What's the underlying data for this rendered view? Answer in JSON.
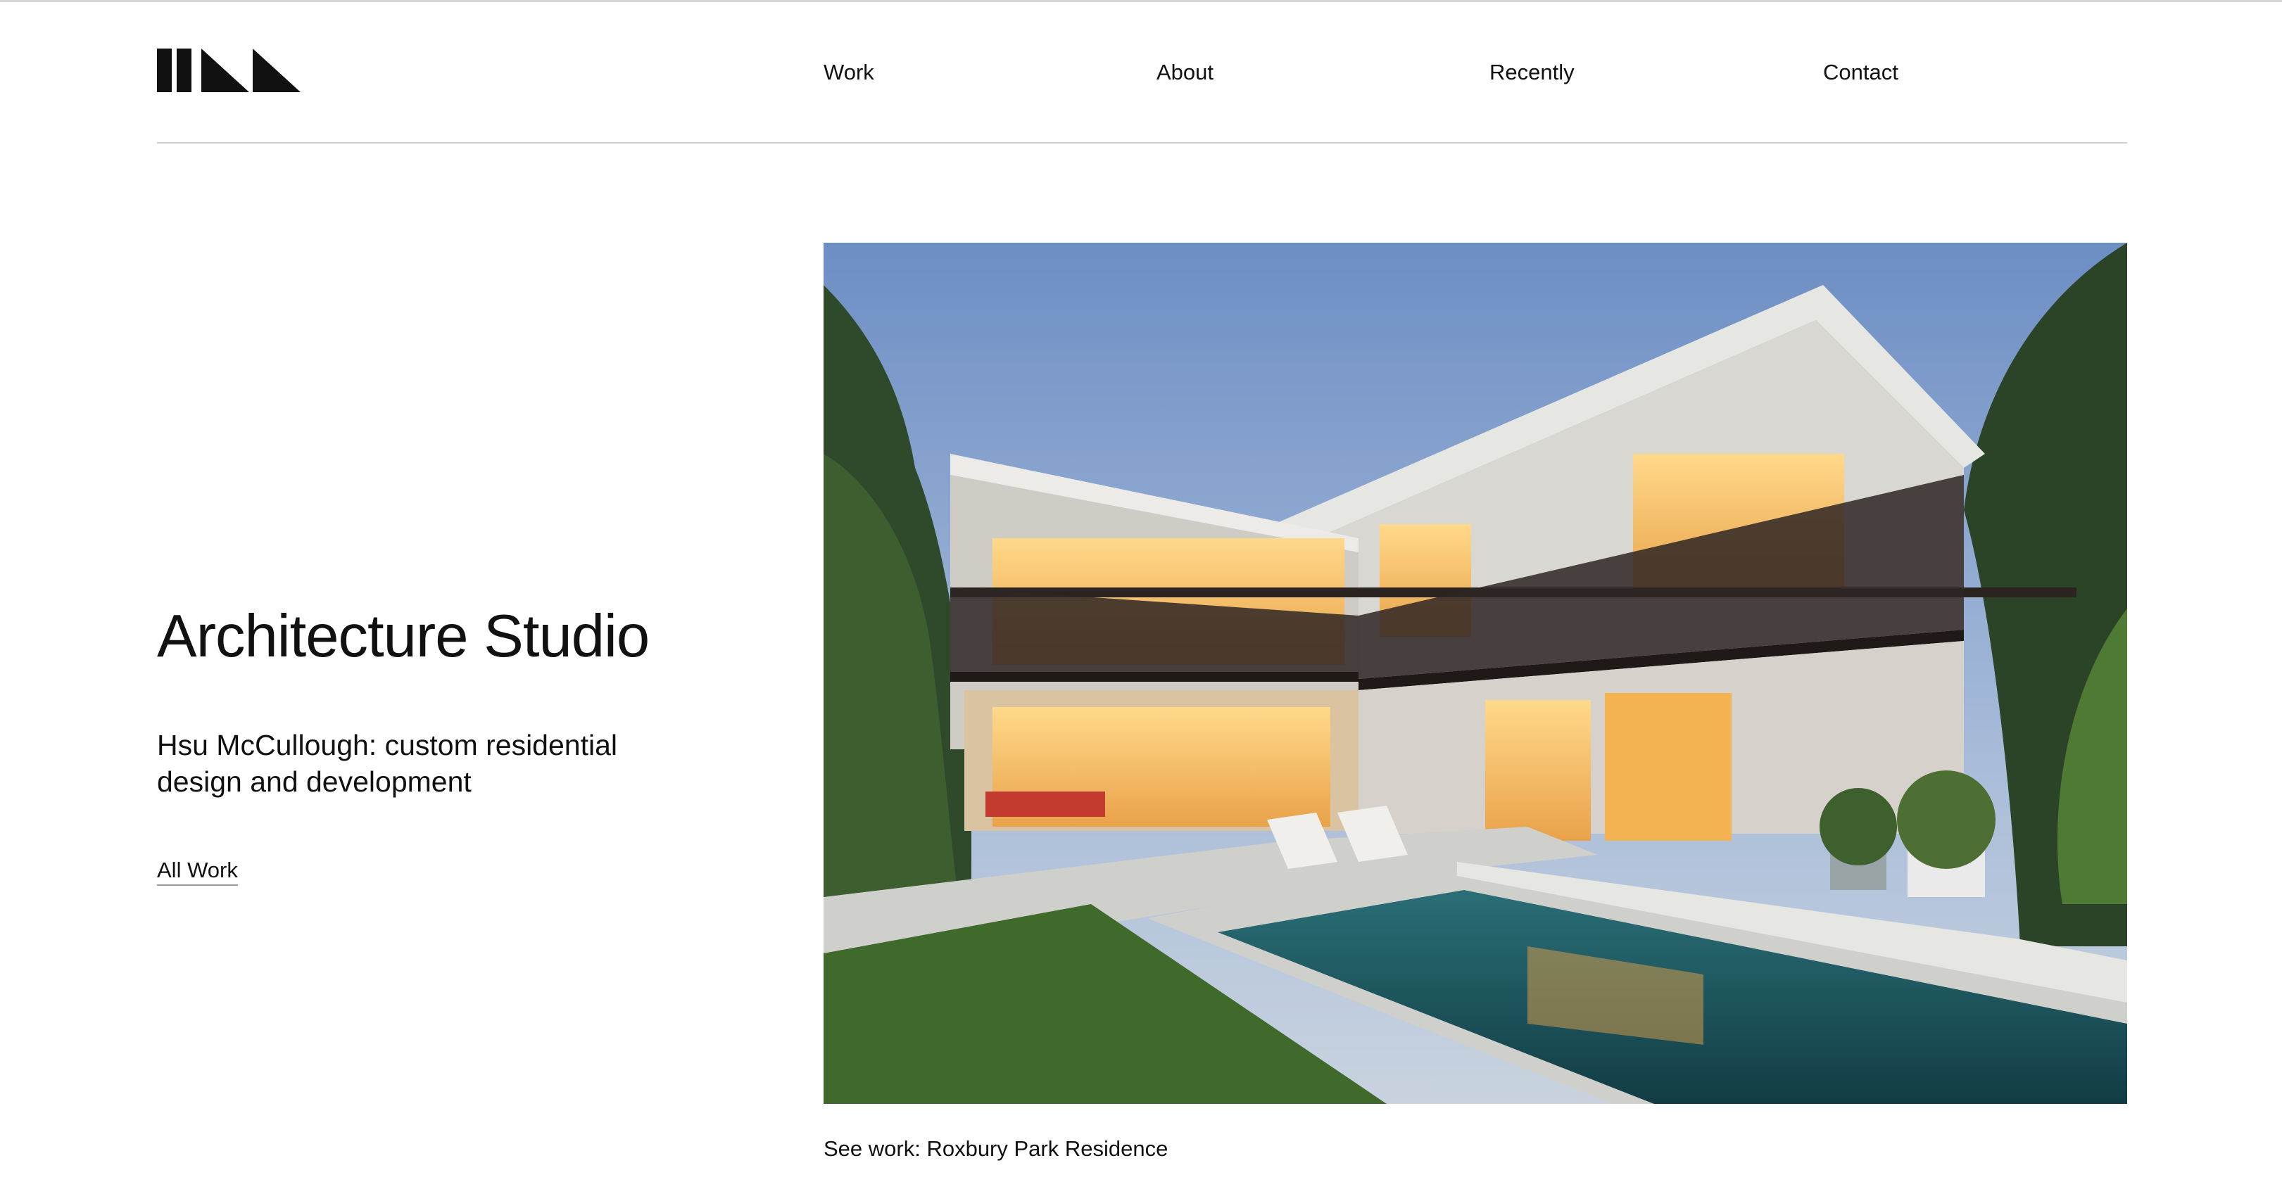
{
  "logo": {
    "name": "studio-logo"
  },
  "nav": {
    "items": [
      {
        "label": "Work"
      },
      {
        "label": "About"
      },
      {
        "label": "Recently"
      },
      {
        "label": "Contact"
      }
    ]
  },
  "hero": {
    "title": "Architecture Studio",
    "subtitle": "Hsu McCullough: custom residential design and development",
    "all_work_label": "All Work"
  },
  "feature": {
    "image": "modern-house-with-pool-at-dusk",
    "caption": "See work: Roxbury Park Residence"
  },
  "colors": {
    "text": "#111111",
    "background": "#ffffff",
    "rule": "#cfcfcf"
  }
}
